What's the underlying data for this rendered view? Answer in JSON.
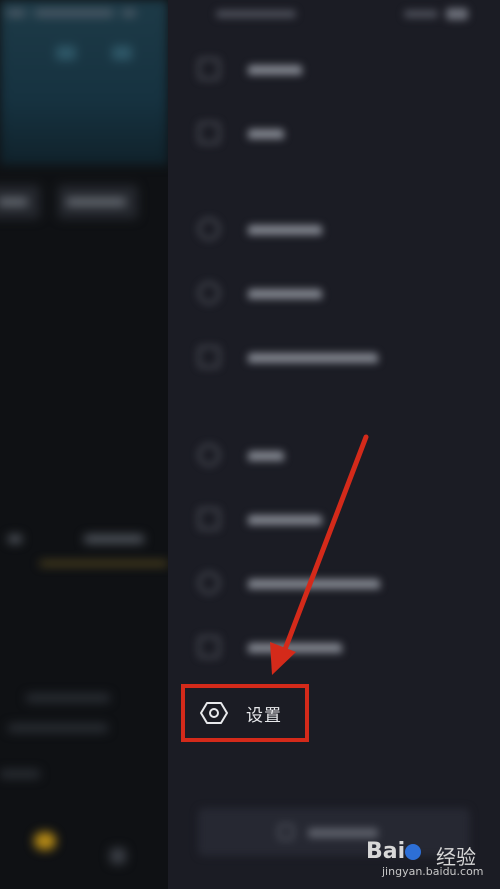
{
  "drawer": {
    "settings": {
      "label": "设置",
      "icon": "hexagon-gear-icon"
    }
  },
  "annotation": {
    "highlight_color": "#d42a1a",
    "arrow_color": "#d42a1a"
  },
  "watermark": {
    "brand": "Bai",
    "brand_suffix": "经验",
    "url": "jingyan.baidu.com"
  }
}
